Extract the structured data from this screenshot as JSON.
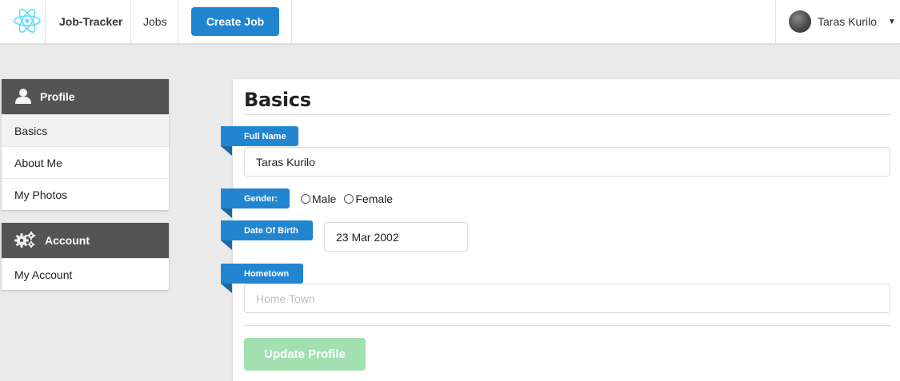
{
  "nav": {
    "brand": "Job-Tracker",
    "jobs_label": "Jobs",
    "create_job_label": "Create Job",
    "user_name": "Taras Kurilo"
  },
  "sidebar": {
    "profile": {
      "title": "Profile",
      "icon": "user-icon",
      "items": [
        {
          "label": "Basics",
          "active": true
        },
        {
          "label": "About Me",
          "active": false
        },
        {
          "label": "My Photos",
          "active": false
        }
      ]
    },
    "account": {
      "title": "Account",
      "icon": "gears-icon",
      "items": [
        {
          "label": "My Account",
          "active": false
        }
      ]
    }
  },
  "form": {
    "title": "Basics",
    "full_name": {
      "label": "Full Name",
      "value": "Taras Kurilo"
    },
    "gender": {
      "label": "Gender:",
      "options": [
        "Male",
        "Female"
      ],
      "selected": null
    },
    "dob": {
      "label": "Date Of Birth",
      "value": "23 Mar 2002"
    },
    "hometown": {
      "label": "Hometown",
      "value": "",
      "placeholder": "Home Town"
    },
    "submit_label": "Update Profile"
  },
  "colors": {
    "primary": "#2185d0",
    "header_dark": "#545454",
    "submit_disabled": "#a3e0b1"
  }
}
